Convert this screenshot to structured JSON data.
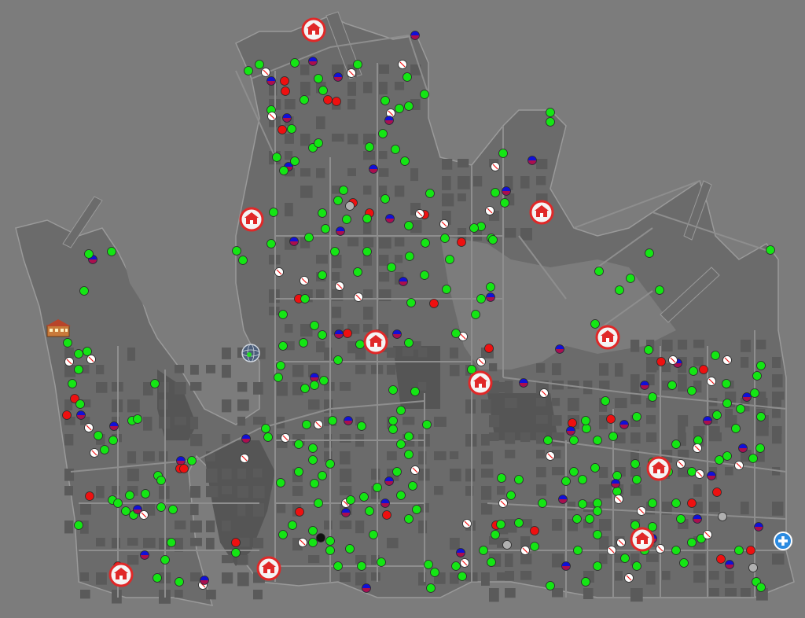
{
  "map": {
    "colors": {
      "background": "#7c7c7c",
      "land": "#6b6b6b",
      "block": "#5a5a5a",
      "road": "#8e8e8e",
      "outline": "#9a9a9a",
      "marker_green": "#14e614",
      "marker_blue": "#1010d8",
      "marker_red": "#ee1010",
      "marker_white": "#ffffff",
      "marker_gray": "#b0b0b0",
      "marker_black": "#111111",
      "pin_fill": "#f4f4f4",
      "pin_border": "#e02828",
      "zoom_button": "#2b8ae0"
    },
    "legend_icons": [
      "hospital-marker-icon",
      "zoom-in-icon",
      "school-building-icon",
      "globe-icon"
    ]
  }
}
